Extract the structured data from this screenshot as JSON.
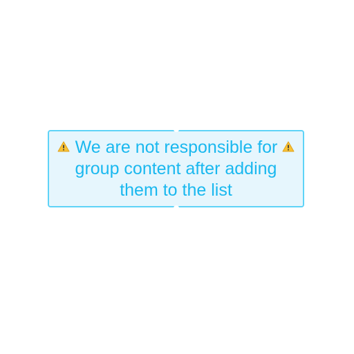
{
  "notice": {
    "line1": "We are not responsible for",
    "line2": "group content after adding",
    "line3": "them to the list",
    "icon": "warning-icon",
    "colors": {
      "text": "#1ab8ef",
      "border": "#5ed3f7",
      "background": "#e6f6fd",
      "icon_fill": "#f8c235",
      "icon_mark": "#3a3a3a"
    }
  }
}
